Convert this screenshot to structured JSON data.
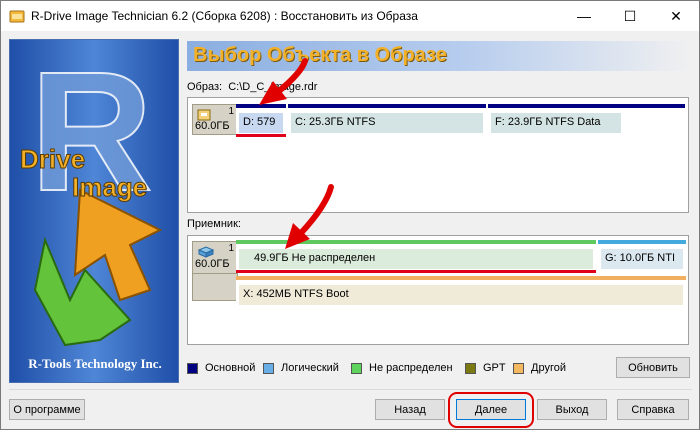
{
  "window": {
    "title": "R-Drive Image Technician 6.2 (Сборка 6208) : Восстановить из Образа",
    "minimize_glyph": "—",
    "maximize_glyph": "☐",
    "close_glyph": "✕"
  },
  "banner": {
    "logo_text_1": "Drive",
    "logo_text_2": "Image",
    "company": "R-Tools Technology Inc."
  },
  "header": {
    "title": "Выбор Объекта в Образе"
  },
  "image_section": {
    "label": "Образ:",
    "path": "C:\\D_C_Image.rdr",
    "disk": {
      "number": "1",
      "size": "60.0ГБ"
    },
    "partitions": [
      {
        "text": "D: 579",
        "color": "#000080",
        "selected": true
      },
      {
        "text": "C: 25.3ГБ  NTFS",
        "color": "#000080",
        "selected": false
      },
      {
        "text": "F: 23.9ГБ  NTFS  Data",
        "color": "#000080",
        "selected": false
      }
    ]
  },
  "dest_section": {
    "label": "Приемник:",
    "disk": {
      "number": "1",
      "size": "60.0ГБ"
    },
    "partitions": [
      {
        "text": "49.9ГБ  Не распределен",
        "color": "#5ec95e",
        "selected": true
      },
      {
        "text": "G: 10.0ГБ  NTI",
        "color": "#44aadd",
        "selected": false
      },
      {
        "text": "X: 452МБ  NTFS  Boot",
        "color": "#f0b060",
        "selected": false
      }
    ]
  },
  "legend": [
    {
      "label": "Основной",
      "color": "#000080"
    },
    {
      "label": "Логический",
      "color": "#6aaee8"
    },
    {
      "label": "Не распределен",
      "color": "#5ed35e"
    },
    {
      "label": "GPT",
      "color": "#7a7a10"
    },
    {
      "label": "Другой",
      "color": "#f4b860"
    }
  ],
  "buttons": {
    "refresh": "Обновить",
    "about": "О программе",
    "back": "Назад",
    "next": "Далее",
    "exit": "Выход",
    "help": "Справка"
  },
  "colors": {
    "highlight": "#e00000",
    "header_text": "#f3b129"
  }
}
